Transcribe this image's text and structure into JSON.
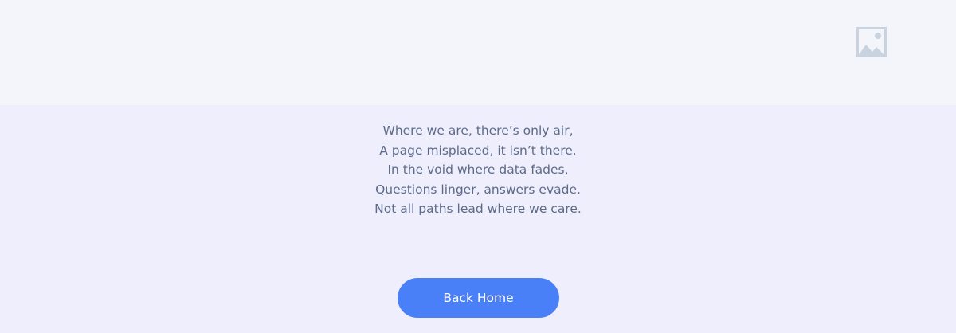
{
  "header": {
    "image_icon": "image-placeholder-icon"
  },
  "poem": {
    "lines": [
      "Where we are, there’s only air,",
      "A page misplaced, it isn’t there.",
      "In the void where data fades,",
      "Questions linger, answers evade.",
      "Not all paths lead where we care."
    ]
  },
  "actions": {
    "back_home_label": "Back Home"
  },
  "colors": {
    "background": "#efeefc",
    "header_background": "#f4f5fa",
    "text": "#5d6b8a",
    "button": "#4a80f7",
    "button_text": "#ffffff",
    "icon": "#c8d3df"
  }
}
